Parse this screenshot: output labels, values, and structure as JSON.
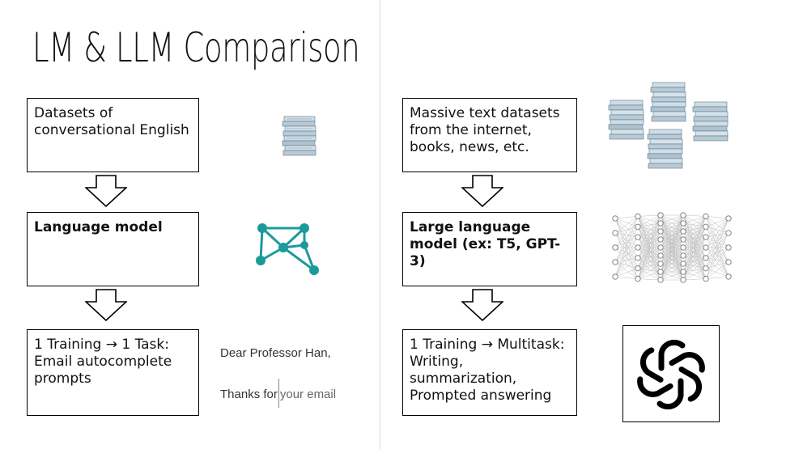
{
  "slide": {
    "title": "LM & LLM Comparison"
  },
  "left": {
    "box1": "Datasets of conversational English",
    "box2": "Language model",
    "box3": "1 Training → 1 Task: Email autocomplete prompts",
    "email": {
      "greeting": "Dear Professor Han,",
      "typed": "Thanks for",
      "suggestion": "your email"
    }
  },
  "right": {
    "box1": "Massive text datasets from the internet, books, news, etc.",
    "box2": "Large language model (ex: T5, GPT-3)",
    "box3": "1 Training → Multitask: Writing, summarization, Prompted answering"
  },
  "icons": {
    "left_dataset": "paper-stack-icon",
    "left_model": "network-graph-icon",
    "right_dataset": "paper-stacks-icon",
    "right_model": "neural-network-icon",
    "right_output": "openai-logo-icon"
  }
}
